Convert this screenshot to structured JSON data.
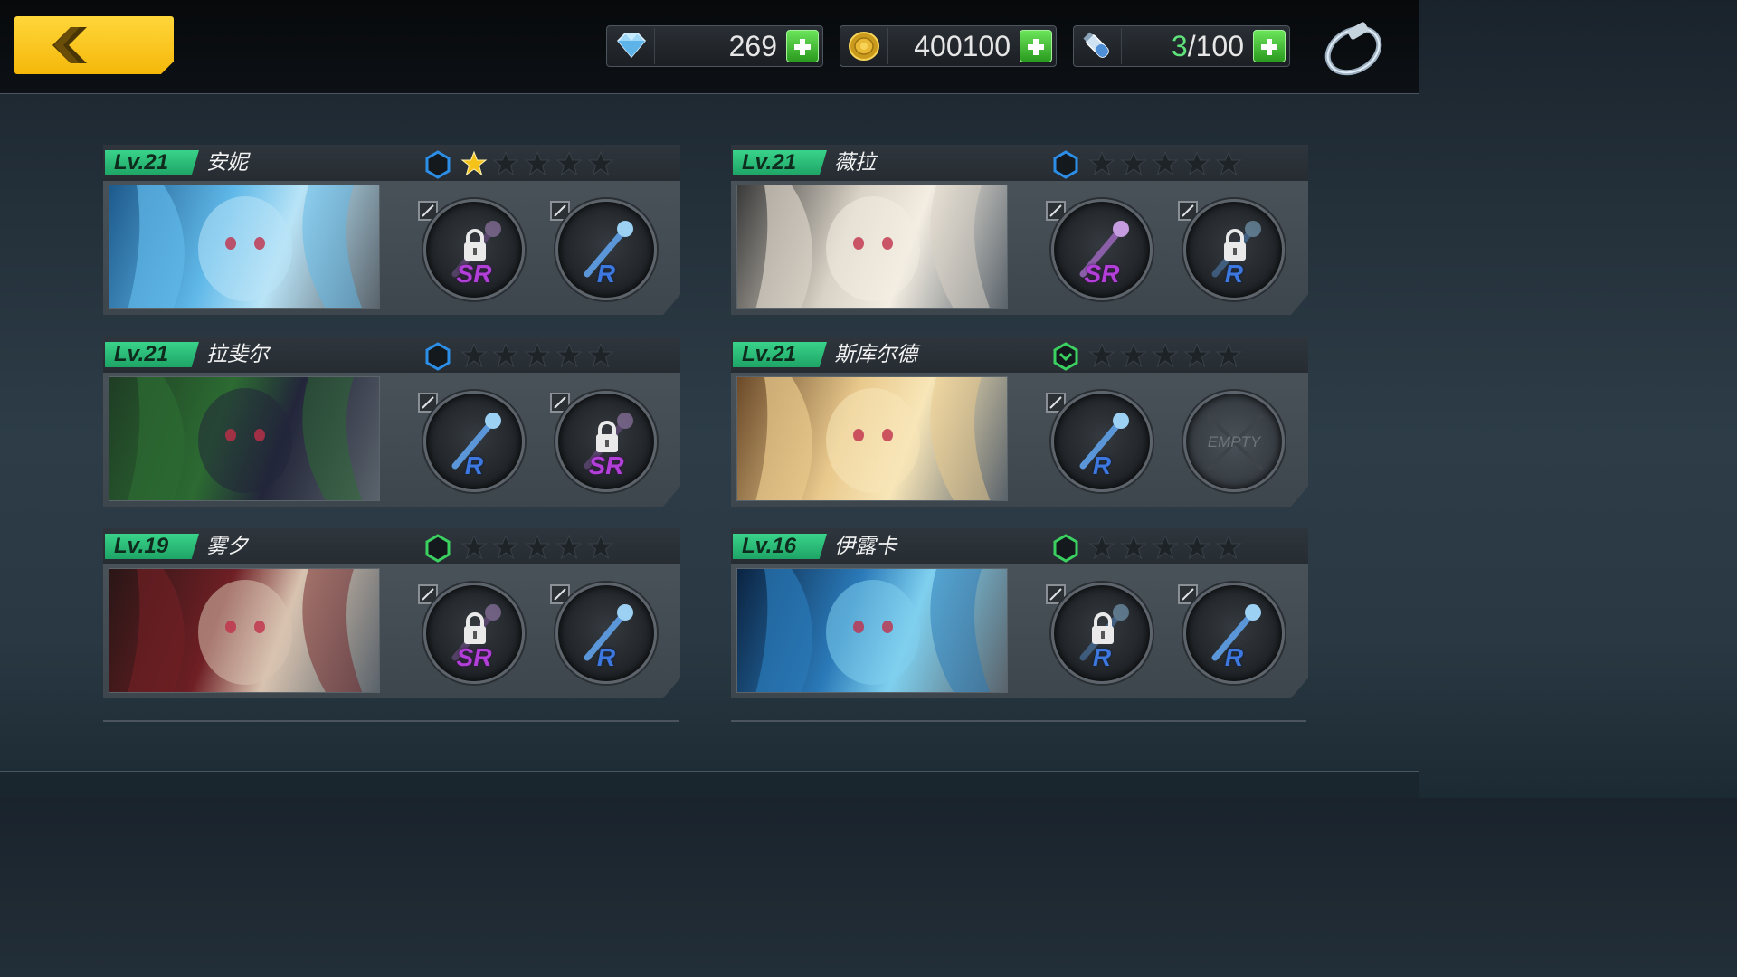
{
  "header": {
    "back_label": "",
    "diamonds": "269",
    "gold": "400100",
    "stamina_current": "3",
    "stamina_total": "/100"
  },
  "characters": [
    {
      "level": "Lv.21",
      "name": "安妮",
      "hex_color": "#2c8ee6",
      "stars": 1,
      "slot1_rarity": "SR",
      "slot1_locked": true,
      "slot2_rarity": "R",
      "slot2_locked": false
    },
    {
      "level": "Lv.21",
      "name": "薇拉",
      "hex_color": "#2c8ee6",
      "stars": 0,
      "slot1_rarity": "SR",
      "slot1_locked": false,
      "slot2_rarity": "R",
      "slot2_locked": true
    },
    {
      "level": "Lv.21",
      "name": "拉斐尔",
      "hex_color": "#2c8ee6",
      "stars": 0,
      "slot1_rarity": "R",
      "slot1_locked": false,
      "slot2_rarity": "SR",
      "slot2_locked": true
    },
    {
      "level": "Lv.21",
      "name": "斯库尔德",
      "hex_color": "#3bd160",
      "stars": 0,
      "slot1_rarity": "R",
      "slot1_locked": false,
      "slot2_empty": "EMPTY"
    },
    {
      "level": "Lv.19",
      "name": "雾夕",
      "hex_color": "#3bd160",
      "stars": 0,
      "slot1_rarity": "SR",
      "slot1_locked": true,
      "slot2_rarity": "R",
      "slot2_locked": false
    },
    {
      "level": "Lv.16",
      "name": "伊露卡",
      "hex_color": "#3bd160",
      "stars": 0,
      "slot1_rarity": "R",
      "slot1_locked": true,
      "slot2_rarity": "R",
      "slot2_locked": false
    }
  ],
  "colors": {
    "star_filled": "#f5c21a",
    "star_empty": "#1e2328",
    "level_badge": "#2fbf7a",
    "sr": "#b13fd8",
    "r": "#3c78e0"
  }
}
